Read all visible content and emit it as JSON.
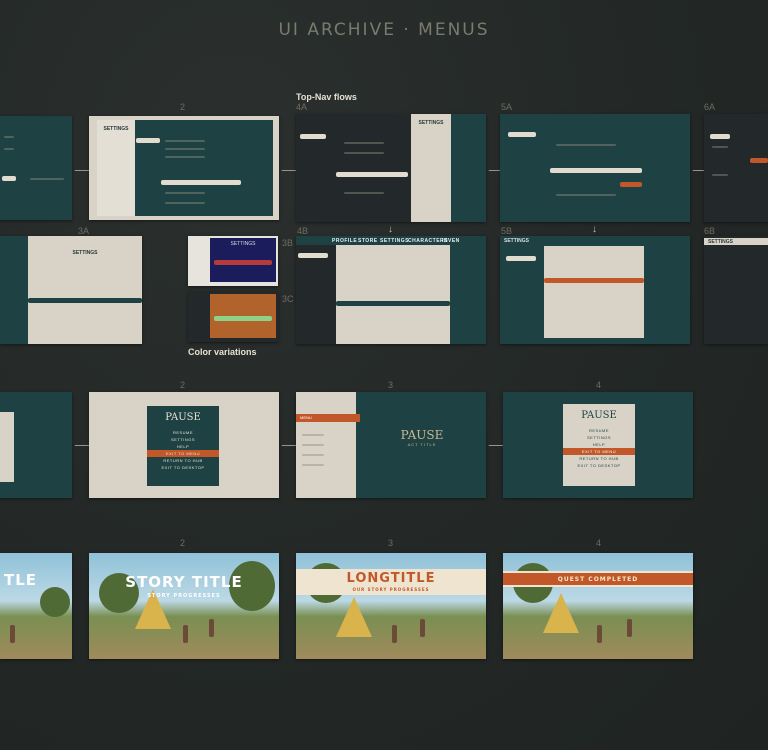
{
  "page": {
    "title": "UI ARCHIVE · MENUS",
    "topnav_label": "Top-Nav flows",
    "color_variations_label": "Color variations"
  },
  "settings_row": {
    "numbers": [
      "2",
      "4A",
      "5A",
      "6A",
      "3A",
      "3B",
      "3C",
      "4B",
      "5B",
      "6B"
    ],
    "panel_titles": [
      "SETTINGS",
      "SETTINGS",
      "SETTINGS",
      "SETTINGS",
      "SETTINGS",
      "SETTINGS",
      "SETTINGS"
    ],
    "sidebar_items": [
      "CONTROLS",
      "GAMEPLAY",
      "HUD",
      "AUDIO",
      "VIDEO",
      "ACCESSIBILITY",
      "LANGUAGE"
    ],
    "topnav_tabs": [
      "PROFILE",
      "STORE",
      "SETTINGS",
      "CHARACTERS",
      "INVEN"
    ]
  },
  "pause_row": {
    "numbers": [
      "2",
      "3",
      "4"
    ],
    "pause_title": "PAUSE",
    "pause_subtitle": "ACT TITLE",
    "items": [
      "RESUME",
      "SETTINGS",
      "HELP",
      "EXIT TO MENU",
      "RETURN TO HUB",
      "EXIT TO DESKTOP"
    ],
    "menu_header": "MENU"
  },
  "story_row": {
    "numbers": [
      "2",
      "3",
      "4"
    ],
    "story_title": "STORY TITLE",
    "left_partial": "TLE",
    "story_sub": "STORY PROGRESSES",
    "longtitle": "LONGTITLE",
    "longtitle_sub": "OUR STORY PROGRESSES",
    "quest": "QUEST COMPLETED"
  },
  "colors": {
    "background": "#232826",
    "teal": "#1e4244",
    "beige": "#d9d3c7",
    "accent_orange": "#c2582a"
  }
}
